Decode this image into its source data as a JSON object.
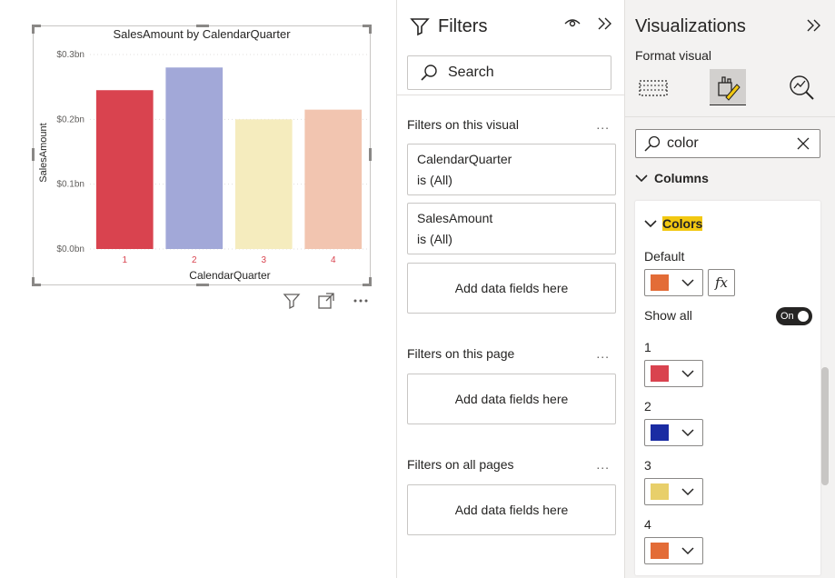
{
  "chart_data": {
    "type": "bar",
    "title": "SalesAmount by CalendarQuarter",
    "xlabel": "CalendarQuarter",
    "ylabel": "SalesAmount",
    "categories": [
      "1",
      "2",
      "3",
      "4"
    ],
    "values": [
      0.245,
      0.28,
      0.2,
      0.215
    ],
    "colors": [
      "#d9434f",
      "#a2a8d8",
      "#f5ecbe",
      "#f2c5b0"
    ],
    "ylim": [
      0,
      0.3
    ],
    "yticks": [
      {
        "value": 0.3,
        "label": "$0.3bn"
      },
      {
        "value": 0.2,
        "label": "$0.2bn"
      },
      {
        "value": 0.1,
        "label": "$0.1bn"
      },
      {
        "value": 0.0,
        "label": "$0.0bn"
      }
    ],
    "grid": true
  },
  "filters": {
    "title": "Filters",
    "search_placeholder": "Search",
    "on_visual_title": "Filters on this visual",
    "cards": [
      {
        "field": "CalendarQuarter",
        "state": "is (All)"
      },
      {
        "field": "SalesAmount",
        "state": "is (All)"
      }
    ],
    "add_fields_label": "Add data fields here",
    "on_page_title": "Filters on this page",
    "on_all_pages_title": "Filters on all pages",
    "more": "..."
  },
  "visualizations": {
    "title": "Visualizations",
    "subtitle": "Format visual",
    "search_value": "color",
    "columns_label": "Columns",
    "colors_label": "Colors",
    "default_label": "Default",
    "default_color": "#e36c37",
    "fx_label": "fx",
    "show_all_label": "Show all",
    "toggle_label": "On",
    "items": [
      {
        "label": "1",
        "color": "#d9434f"
      },
      {
        "label": "2",
        "color": "#1a2ca3"
      },
      {
        "label": "3",
        "color": "#e8cf6a"
      },
      {
        "label": "4",
        "color": "#e36c37"
      }
    ]
  },
  "icons": [
    "filter-icon",
    "eye-icon",
    "collapse-icon",
    "search-icon",
    "more-icon",
    "focus-mode-icon",
    "format-icon",
    "build-icon",
    "analytics-icon",
    "clear-icon",
    "chevron-down-icon"
  ]
}
